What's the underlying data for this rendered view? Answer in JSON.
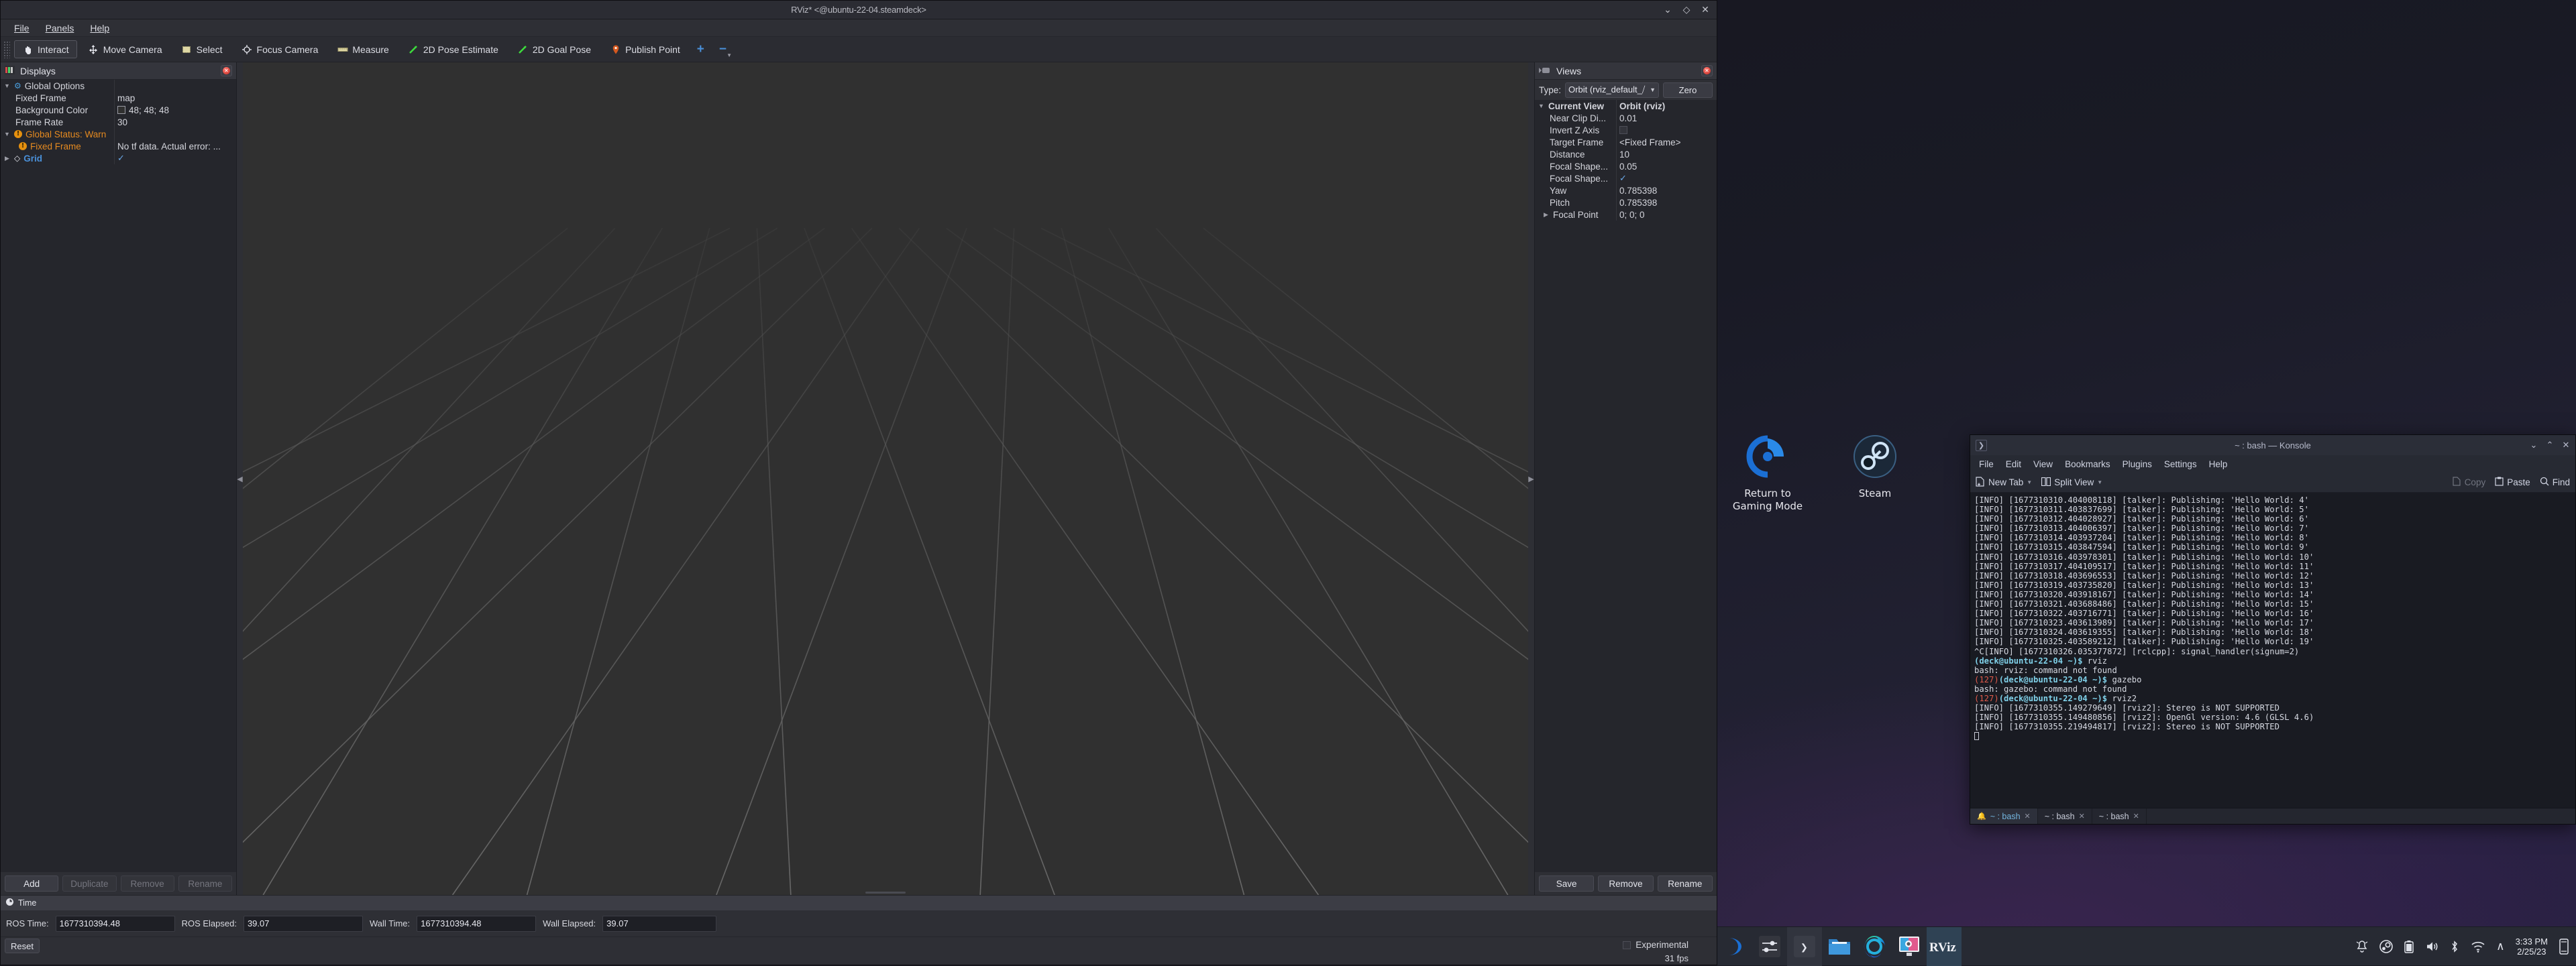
{
  "desktop": {
    "icons": [
      {
        "label": "Return to\nGaming Mode",
        "name": "return-to-gaming-mode"
      },
      {
        "label": "Steam",
        "name": "steam"
      }
    ]
  },
  "rviz": {
    "title": "RViz* <@ubuntu-22-04.steamdeck>",
    "window_buttons": {
      "minimize": "⌄",
      "maximize": "◇",
      "close": "✕"
    },
    "menu": [
      {
        "label": "File"
      },
      {
        "label": "Panels"
      },
      {
        "label": "Help"
      }
    ],
    "toolbar": [
      {
        "label": "Interact",
        "icon": "interact-icon",
        "active": true
      },
      {
        "label": "Move Camera",
        "icon": "move-camera-icon",
        "active": false
      },
      {
        "label": "Select",
        "icon": "select-icon",
        "active": false
      },
      {
        "label": "Focus Camera",
        "icon": "focus-camera-icon",
        "active": false
      },
      {
        "label": "Measure",
        "icon": "measure-icon",
        "active": false
      },
      {
        "label": "2D Pose Estimate",
        "icon": "pose-estimate-icon",
        "active": false
      },
      {
        "label": "2D Goal Pose",
        "icon": "goal-pose-icon",
        "active": false
      },
      {
        "label": "Publish Point",
        "icon": "publish-point-icon",
        "active": false
      }
    ],
    "toolbar_add": "+",
    "toolbar_remove": "−",
    "displays": {
      "title": "Displays",
      "rows": [
        {
          "name": "Global Options",
          "value": "",
          "expander": "down",
          "icon": "gear-icon",
          "style": "bold-plain",
          "indent": 0
        },
        {
          "name": "Fixed Frame",
          "value": "map",
          "expander": "none",
          "icon": "none",
          "style": "plain",
          "indent": 1
        },
        {
          "name": "Background Color",
          "value": "48; 48; 48",
          "expander": "none",
          "icon": "none",
          "style": "plain",
          "indent": 1,
          "value_icon": "color-swatch"
        },
        {
          "name": "Frame Rate",
          "value": "30",
          "expander": "none",
          "icon": "none",
          "style": "plain",
          "indent": 1
        },
        {
          "name": "Global Status: Warn",
          "value": "",
          "expander": "down",
          "icon": "warn-icon",
          "style": "warn",
          "indent": 0
        },
        {
          "name": "Fixed Frame",
          "value": "No tf data.  Actual error: ...",
          "expander": "none",
          "icon": "warn-icon",
          "style": "warn",
          "indent": 1
        },
        {
          "name": "Grid",
          "value": "",
          "expander": "right",
          "icon": "grid-icon",
          "style": "link",
          "indent": 0,
          "value_icon": "check"
        }
      ],
      "buttons": [
        {
          "label": "Add",
          "enabled": true
        },
        {
          "label": "Duplicate",
          "enabled": false
        },
        {
          "label": "Remove",
          "enabled": false
        },
        {
          "label": "Rename",
          "enabled": false
        }
      ]
    },
    "views": {
      "title": "Views",
      "type_label": "Type:",
      "type_value": "Orbit (rviz_default_⧸",
      "zero_button": "Zero",
      "rows": [
        {
          "name": "Current View",
          "value": "Orbit (rviz)",
          "expander": "down",
          "style": "bold",
          "indent": 0
        },
        {
          "name": "Near Clip Di...",
          "value": "0.01",
          "expander": "none",
          "style": "plain",
          "indent": 1
        },
        {
          "name": "Invert Z Axis",
          "value": "",
          "expander": "none",
          "style": "plain",
          "indent": 1,
          "value_icon": "checkbox-empty"
        },
        {
          "name": "Target Frame",
          "value": "<Fixed Frame>",
          "expander": "none",
          "style": "plain",
          "indent": 1
        },
        {
          "name": "Distance",
          "value": "10",
          "expander": "none",
          "style": "plain",
          "indent": 1
        },
        {
          "name": "Focal Shape...",
          "value": "0.05",
          "expander": "none",
          "style": "plain",
          "indent": 1
        },
        {
          "name": "Focal Shape...",
          "value": "",
          "expander": "none",
          "style": "plain",
          "indent": 1,
          "value_icon": "check"
        },
        {
          "name": "Yaw",
          "value": "0.785398",
          "expander": "none",
          "style": "plain",
          "indent": 1
        },
        {
          "name": "Pitch",
          "value": "0.785398",
          "expander": "none",
          "style": "plain",
          "indent": 1
        },
        {
          "name": "Focal Point",
          "value": "0; 0; 0",
          "expander": "right",
          "style": "plain",
          "indent": 1
        }
      ],
      "buttons": [
        {
          "label": "Save"
        },
        {
          "label": "Remove"
        },
        {
          "label": "Rename"
        }
      ]
    },
    "time": {
      "title": "Time",
      "fields": [
        {
          "label": "ROS Time:",
          "value": "1677310394.48"
        },
        {
          "label": "ROS Elapsed:",
          "value": "39.07"
        },
        {
          "label": "Wall Time:",
          "value": "1677310394.48"
        },
        {
          "label": "Wall Elapsed:",
          "value": "39.07"
        }
      ]
    },
    "status": {
      "reset": "Reset",
      "experimental": "Experimental",
      "fps": "31 fps"
    }
  },
  "konsole": {
    "title": "~ : bash — Konsole",
    "window_buttons": {
      "minimize": "⌄",
      "maximize": "⌃",
      "close": "✕"
    },
    "menu": [
      {
        "label": "File"
      },
      {
        "label": "Edit"
      },
      {
        "label": "View"
      },
      {
        "label": "Bookmarks"
      },
      {
        "label": "Plugins"
      },
      {
        "label": "Settings"
      },
      {
        "label": "Help"
      }
    ],
    "toolbar": {
      "new_tab": "New Tab",
      "split_view": "Split View",
      "copy": "Copy",
      "paste": "Paste",
      "find": "Find"
    },
    "terminal_lines": [
      {
        "text": "[INFO] [1677310310.404008118] [talker]: Publishing: 'Hello World: 4'"
      },
      {
        "text": "[INFO] [1677310311.403837699] [talker]: Publishing: 'Hello World: 5'"
      },
      {
        "text": "[INFO] [1677310312.404028927] [talker]: Publishing: 'Hello World: 6'"
      },
      {
        "text": "[INFO] [1677310313.404006397] [talker]: Publishing: 'Hello World: 7'"
      },
      {
        "text": "[INFO] [1677310314.403937204] [talker]: Publishing: 'Hello World: 8'"
      },
      {
        "text": "[INFO] [1677310315.403847594] [talker]: Publishing: 'Hello World: 9'"
      },
      {
        "text": "[INFO] [1677310316.403978301] [talker]: Publishing: 'Hello World: 10'"
      },
      {
        "text": "[INFO] [1677310317.404109517] [talker]: Publishing: 'Hello World: 11'"
      },
      {
        "text": "[INFO] [1677310318.403696553] [talker]: Publishing: 'Hello World: 12'"
      },
      {
        "text": "[INFO] [1677310319.403735820] [talker]: Publishing: 'Hello World: 13'"
      },
      {
        "text": "[INFO] [1677310320.403918167] [talker]: Publishing: 'Hello World: 14'"
      },
      {
        "text": "[INFO] [1677310321.403688486] [talker]: Publishing: 'Hello World: 15'"
      },
      {
        "text": "[INFO] [1677310322.403716771] [talker]: Publishing: 'Hello World: 16'"
      },
      {
        "text": "[INFO] [1677310323.403613989] [talker]: Publishing: 'Hello World: 17'"
      },
      {
        "text": "[INFO] [1677310324.403619355] [talker]: Publishing: 'Hello World: 18'"
      },
      {
        "text": "[INFO] [1677310325.403589212] [talker]: Publishing: 'Hello World: 19'"
      },
      {
        "text": "^C[INFO] [1677310326.035377872] [rclcpp]: signal_handler(signum=2)"
      },
      {
        "prompt": true,
        "exit": "",
        "host": "(deck@ubuntu-22-04 ~)$",
        "cmd": " rviz"
      },
      {
        "text": "bash: rviz: command not found"
      },
      {
        "prompt": true,
        "exit": "(127)",
        "host": "(deck@ubuntu-22-04 ~)$",
        "cmd": " gazebo"
      },
      {
        "text": "bash: gazebo: command not found"
      },
      {
        "prompt": true,
        "exit": "(127)",
        "host": "(deck@ubuntu-22-04 ~)$",
        "cmd": " rviz2"
      },
      {
        "text": "[INFO] [1677310355.149279649] [rviz2]: Stereo is NOT SUPPORTED"
      },
      {
        "text": "[INFO] [1677310355.149480856] [rviz2]: OpenGl version: 4.6 (GLSL 4.6)"
      },
      {
        "text": "[INFO] [1677310355.219494817] [rviz2]: Stereo is NOT SUPPORTED"
      }
    ],
    "tabs": [
      {
        "label": "~ : bash",
        "active": true,
        "bell": true
      },
      {
        "label": "~ : bash",
        "active": false,
        "bell": false
      },
      {
        "label": "~ : bash",
        "active": false,
        "bell": false
      }
    ]
  },
  "taskbar": {
    "items": [
      {
        "name": "launcher",
        "state": "idle"
      },
      {
        "name": "settings",
        "state": "idle"
      },
      {
        "name": "konsole",
        "state": "running"
      },
      {
        "name": "file-manager",
        "state": "idle"
      },
      {
        "name": "edge-browser",
        "state": "idle"
      },
      {
        "name": "screenshot-tool",
        "state": "idle"
      },
      {
        "name": "rviz",
        "state": "focused",
        "label": "RViz"
      }
    ],
    "tray": [
      {
        "name": "notifications-icon",
        "glyph": "🔔"
      },
      {
        "name": "steam-icon",
        "glyph": "●"
      },
      {
        "name": "battery-icon",
        "glyph": "▓"
      },
      {
        "name": "volume-icon",
        "glyph": "🔊"
      },
      {
        "name": "bluetooth-icon",
        "glyph": "ᛦ"
      },
      {
        "name": "wifi-icon",
        "glyph": "◠"
      },
      {
        "name": "show-hidden-icon",
        "glyph": "∧"
      }
    ],
    "clock": {
      "time": "3:33 PM",
      "date": "2/25/23"
    }
  },
  "colors": {
    "accent": "#4a90d9",
    "warn": "#e58a20",
    "viewport_bg": "#303030",
    "panel_bg": "#2e2f35"
  }
}
